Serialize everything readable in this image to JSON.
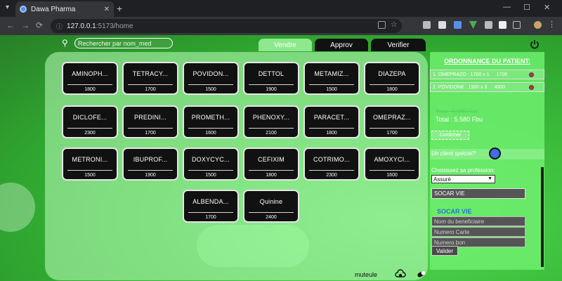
{
  "browser": {
    "tab_title": "Dawa Pharma",
    "tab_close": "✕",
    "new_tab": "+",
    "minimize": "—",
    "maximize": "☐",
    "close": "✕",
    "url_host": "127.0.0.1",
    "url_port_path": ":5173/home",
    "back": "←",
    "forward": "→",
    "reload": "⟳"
  },
  "search": {
    "placeholder": "Rechercher par nom_med"
  },
  "nav_tabs": [
    "Vendre",
    "Approv",
    "Verifier"
  ],
  "products": [
    {
      "name": "AMINOPH...",
      "price": "1800"
    },
    {
      "name": "TETRACY...",
      "price": "1700"
    },
    {
      "name": "POVIDON...",
      "price": "1500"
    },
    {
      "name": "DETTOL",
      "price": "1900"
    },
    {
      "name": "METAMIZ...",
      "price": "1500"
    },
    {
      "name": "DIAZEPA",
      "price": "1800"
    },
    {
      "name": "DICLOFE...",
      "price": "2300"
    },
    {
      "name": "PREDINI...",
      "price": "1700"
    },
    {
      "name": "PROMETH...",
      "price": "1600"
    },
    {
      "name": "PHENOXY...",
      "price": "2100"
    },
    {
      "name": "PARACET...",
      "price": "1800"
    },
    {
      "name": "OMEPRAZ...",
      "price": "1700"
    },
    {
      "name": "METRONI...",
      "price": "1500"
    },
    {
      "name": "IBUPROF...",
      "price": "1900"
    },
    {
      "name": "DOXYCYC...",
      "price": "1500"
    },
    {
      "name": "CEFIXIM",
      "price": "1800"
    },
    {
      "name": "COTRIMO...",
      "price": "2300"
    },
    {
      "name": "AMOXYCI...",
      "price": "1600"
    },
    {
      "name": "ALBENDA...",
      "price": "1700"
    },
    {
      "name": "Quinine",
      "price": "2400"
    }
  ],
  "order": {
    "title": "ORDONNANCE DU PATIENT:",
    "items": [
      {
        "text": "1. OMEPRAZO : 1700 x 1",
        "amount": "1700"
      },
      {
        "text": "2. POVIDONE : 1500 x 3",
        "amount": "4500"
      }
    ],
    "total_old": "Total : 5.580 Fbu",
    "total_new": "Total : 5.580 Fbu",
    "confirm_label": "Confirmer",
    "special_client_label": "Un client spécial?",
    "profession_label": "Choisissez sa profession:",
    "profession_value": "Assuré",
    "mutuelle_value": "SOCAR VIE",
    "mutuelle_title": "SOCAR VIE",
    "fields": [
      "Nom du beneficiaire",
      "Numero Carte",
      "Numero bon"
    ],
    "validate_label": "Valider"
  },
  "footer": {
    "mutuelle_label": "muteule"
  },
  "colors": {
    "accent_green": "#3ec13e",
    "card_bg": "#111111",
    "toggle_blue": "#3f6fe0"
  }
}
